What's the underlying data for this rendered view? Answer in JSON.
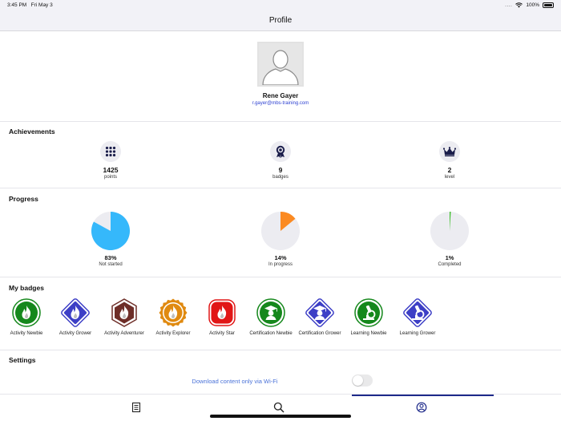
{
  "status": {
    "time": "3:45 PM",
    "date": "Fri May 3",
    "signal": "....",
    "battery": "100%"
  },
  "nav": {
    "title": "Profile"
  },
  "profile": {
    "name": "Rene Gayer",
    "email": "r.gayer@mbs-training.com",
    "avatar_icon": "person-silhouette-icon"
  },
  "achievements": {
    "title": "Achievements",
    "items": [
      {
        "value": "1425",
        "label": "points",
        "icon": "grid-dots-icon"
      },
      {
        "value": "9",
        "label": "badges",
        "icon": "medal-icon"
      },
      {
        "value": "2",
        "label": "level",
        "icon": "crown-icon"
      }
    ]
  },
  "progress": {
    "title": "Progress",
    "items": [
      {
        "value": "83%",
        "label": "Not started",
        "fraction": 0.83,
        "color": "#35b8fb"
      },
      {
        "value": "14%",
        "label": "In progress",
        "fraction": 0.14,
        "color": "#fb8a22"
      },
      {
        "value": "1%",
        "label": "Completed",
        "fraction": 0.01,
        "color": "#3dbf2a"
      }
    ],
    "track_color": "#ececf1"
  },
  "badges": {
    "title": "My badges",
    "items": [
      {
        "label": "Activity Newbie",
        "icon": "flame-icon",
        "shape": "circle",
        "color": "#15881c"
      },
      {
        "label": "Activity Grower",
        "icon": "flame-icon",
        "shape": "diamond",
        "color": "#3d3fc6"
      },
      {
        "label": "Activity Adventurer",
        "icon": "flame-icon",
        "shape": "hexagon",
        "color": "#6e2e28"
      },
      {
        "label": "Activity Explorer",
        "icon": "flame-icon",
        "shape": "seal",
        "color": "#e08a10"
      },
      {
        "label": "Activity Star",
        "icon": "flame-icon",
        "shape": "rounded-square",
        "color": "#e11616"
      },
      {
        "label": "Certification Newbie",
        "icon": "graduate-icon",
        "shape": "circle",
        "color": "#15881c"
      },
      {
        "label": "Certification Grower",
        "icon": "graduate-icon",
        "shape": "diamond",
        "color": "#3d3fc6"
      },
      {
        "label": "Learning Newbie",
        "icon": "microscope-icon",
        "shape": "circle",
        "color": "#15881c"
      },
      {
        "label": "Learning Grower",
        "icon": "microscope-icon",
        "shape": "diamond",
        "color": "#3d3fc6"
      }
    ]
  },
  "settings": {
    "title": "Settings",
    "wifi_label": "Download content only via Wi-Fi",
    "wifi_enabled": false
  },
  "tabbar": {
    "tabs": [
      {
        "icon": "catalog-icon",
        "selected": false
      },
      {
        "icon": "search-icon",
        "selected": false
      },
      {
        "icon": "profile-icon",
        "selected": true
      }
    ],
    "active_color": "#1e2a8a"
  }
}
